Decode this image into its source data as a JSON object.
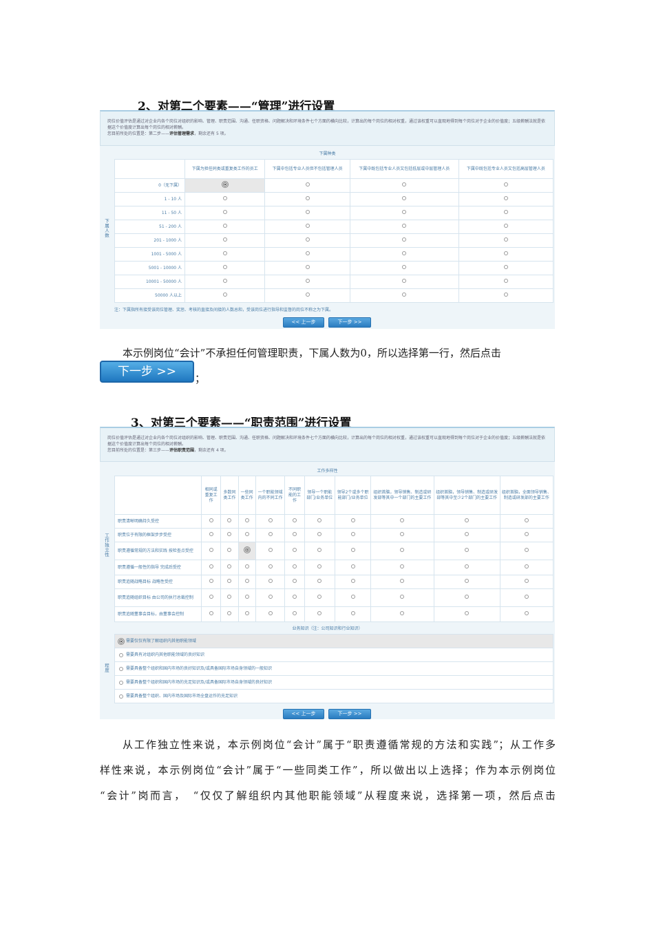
{
  "section2": {
    "heading": "2、对第二个要素——“管理”进行设置",
    "info_line1": "岗位价值评估是通过对企业内各个岗位对组织的影响、管理、职责范围、沟通、任职资格、问题解决和环境条件七个方面的横向比较，计算出的每个岗位的相对权重，通过该权重可以直观地得到每个岗位对于企业的价值度；五级薪酬法就是依据这个价值度计算出每个岗位的相对薪酬。",
    "info_line2_prefix": "您目前所处的位置是：第二步——",
    "info_line2_step": "评估管理需求",
    "info_line2_suffix": "，剩余还有 5 项。",
    "caption": "下属种类",
    "side_label": "下属人数",
    "columns": [
      "下属为担任同类或重复类工作的员工",
      "下属中包括专业人员但不包括管理人员",
      "下属中既包括专业人员又包括低层或中层管理人员",
      "下属中既包括专业人员又包括高层管理人员"
    ],
    "rows": [
      "0（无下属）",
      "1 - 10 人",
      "11 - 50 人",
      "51 - 200 人",
      "201 - 1000 人",
      "1001 - 5000 人",
      "5001 - 10000 人",
      "10001 - 50000 人",
      "50000 人以上"
    ],
    "selected": {
      "row": 0,
      "col": 0
    },
    "note": "注：下属指所有接受该岗位管理、奖惩、考核的直接及间接的人数总和，受该岗位进行指导和监督的岗位不称之为下属。",
    "prev": "<< 上一步",
    "next": "下一步 >>"
  },
  "para1": "本示例岗位“会计”不承担任何管理职责，下属人数为0，所以选择第一行，然后点击",
  "big_next": "下一步 >>",
  "para1_end": "；",
  "section3": {
    "heading": "3、对第三个要素——“职责范围”进行设置",
    "info_line1": "岗位价值评估是通过对企业内各个岗位对组织的影响、管理、职责范围、沟通、任职资格、问题解决和环境条件七个方面的横向比较，计算出的每个岗位的相对权重，通过该权重可以直观地得到每个岗位对于企业的价值度；五级薪酬法就是依据这个价值度计算出每个岗位的相对薪酬。",
    "info_line2_prefix": "您目前所处的位置是：第三步——",
    "info_line2_step": "评估职责范围",
    "info_line2_suffix": "，剩余还有 4 项。",
    "caption": "工作多样性",
    "side_label": "工作独立性",
    "columns": [
      "相同或重复工作",
      "多数同类工作",
      "一些同类工作",
      "一个职能领域内的不同工作",
      "不同职能的工作",
      "领导一个职能部门/业务单位",
      "领导2个或多个职能部门/业务单位",
      "组织首脑，领导销售、制造或研发部等其中一个部门的主要工作",
      "组织首脑，领导销售、制造或研发部等其中至少2个部门的主要工作",
      "组织首脑，全面领导销售、制造或研发部的主要工作"
    ],
    "rows": [
      "职责清晰明确持久受控",
      "职责位于有限的框架步步受控",
      "职责遵循常规的方法和实践 按检查点受控",
      "职责遵循一般性的指导 完成后受控",
      "职责追随战略目标 战略性受控",
      "职责追随组织目标 由公司的执行总裁控制",
      "职责追随董事会目标，由董事会控制"
    ],
    "selected": {
      "row": 2,
      "col": 2
    },
    "knowledge_caption": "业务知识（注：公司知识和行业知识）",
    "degree_label": "程度",
    "options": [
      "需要仅仅有限了解组织内其他职能领域",
      "需要具有对组织内其他职能领域的良好知识",
      "需要具备整个组织和国内市场的良好知识及/或具备国际市场自身领域的一般知识",
      "需要具备整个组织和国内市场的充足知识及/或具备国际市场自身领域的良好知识",
      "需要具备整个组织、国内市场及国际市场全盘运作的充足知识"
    ],
    "selected_option": 0,
    "prev": "<< 上一步",
    "next": "下一步 >>"
  },
  "para2": [
    "从工作独立性来说，本示例岗位“会计”属于“职责遵循常规的方法和实践”；从工作多",
    "样性来说，本示例岗位“会计”属于“一些同类工作”，所以做出以上选择；作为本示例岗位",
    "“会计”岗而言，　“仅仅了解组织内其他职能领域”从程度来说，选择第一项，然后点击"
  ]
}
